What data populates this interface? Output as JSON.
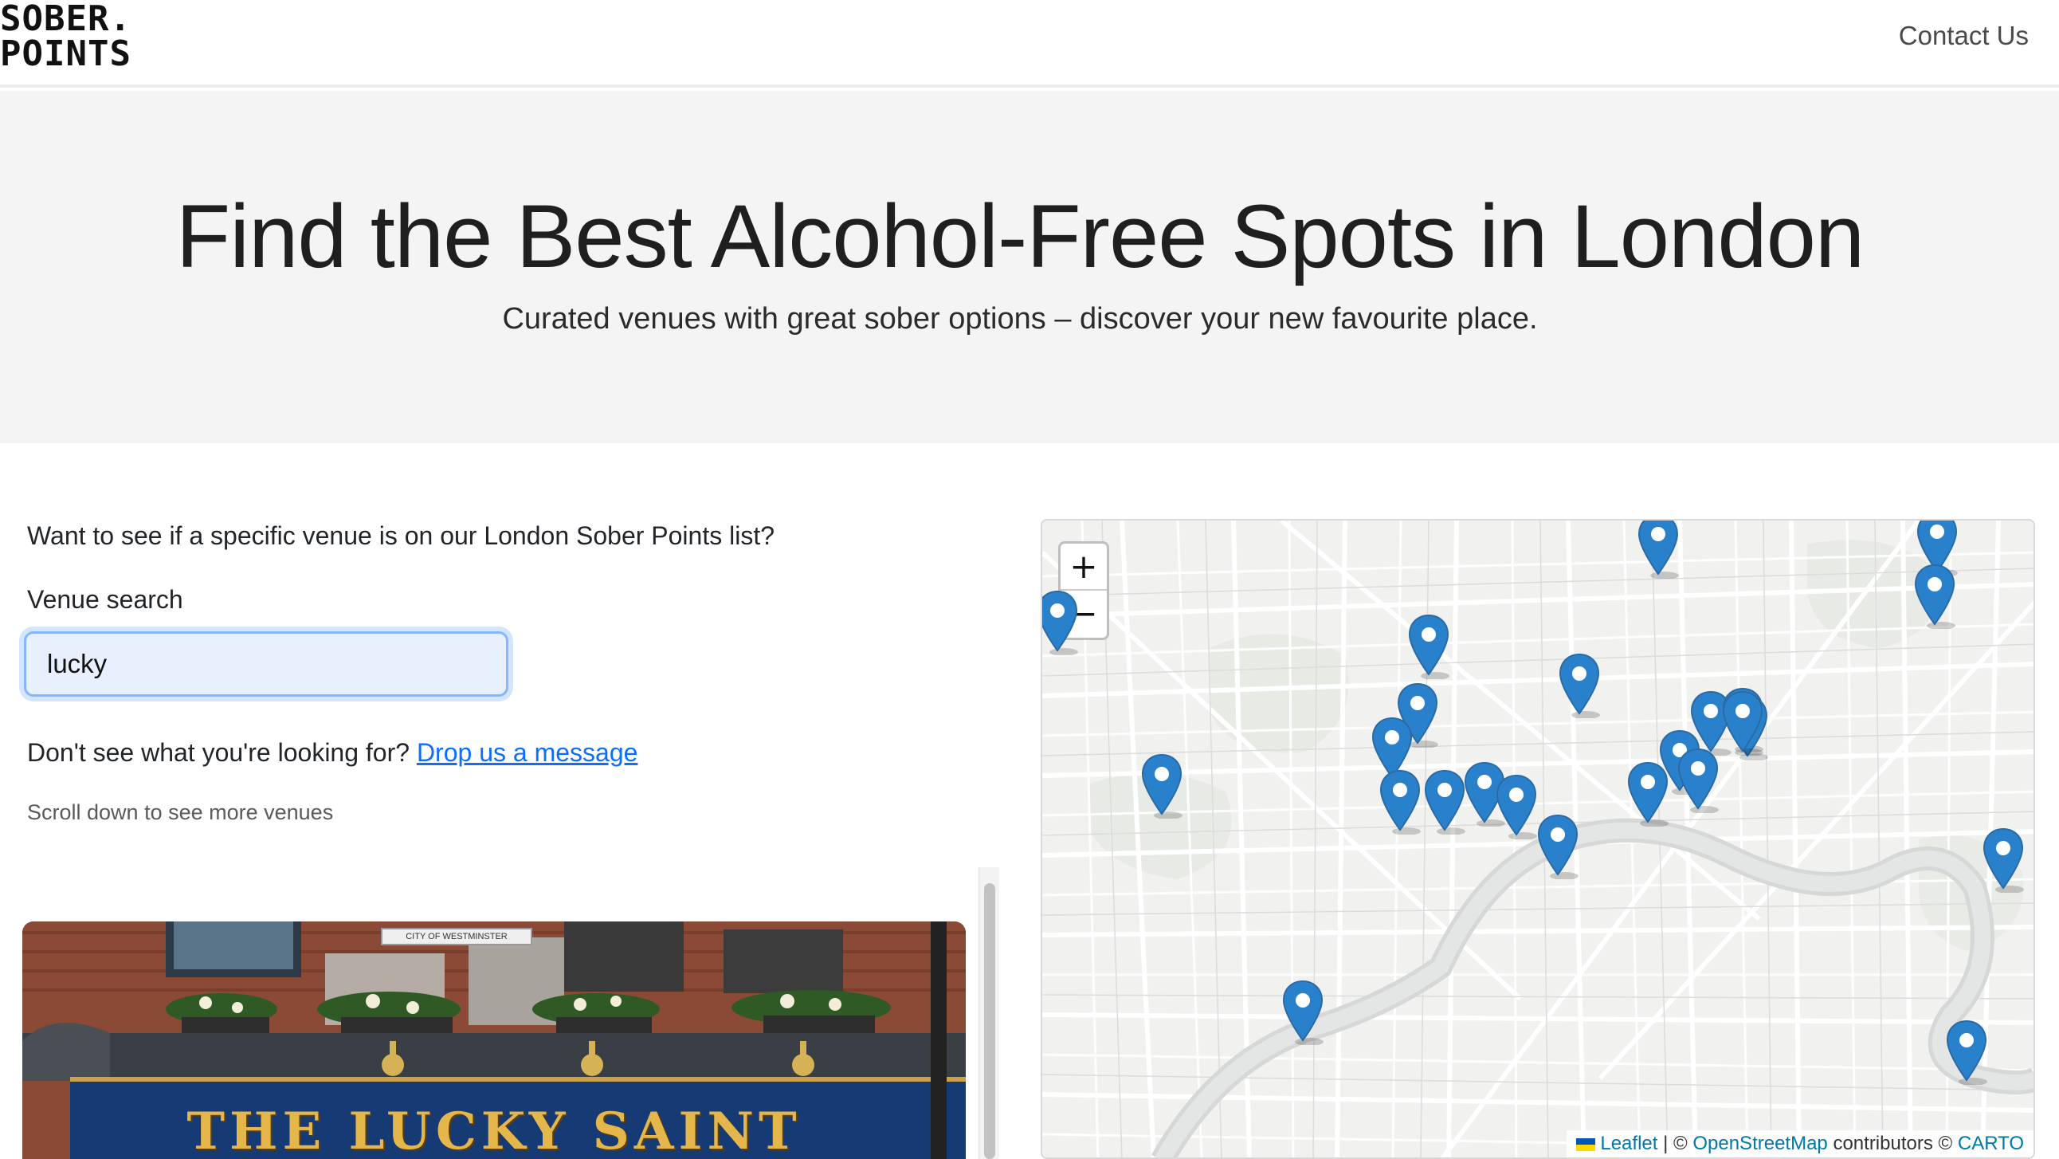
{
  "nav": {
    "logo_line1": "SOBER.",
    "logo_line2": "POINTS",
    "contact": "Contact Us"
  },
  "hero": {
    "title": "Find the Best Alcohol-Free Spots in London",
    "subtitle": "Curated venues with great sober options – discover your new favourite place."
  },
  "search": {
    "question": "Want to see if a specific venue is on our London Sober Points list?",
    "label": "Venue search",
    "value": "lucky",
    "not_found_text": "Don't see what you're looking for?",
    "not_found_link": "Drop us a message",
    "scroll_hint": "Scroll down to see more venues"
  },
  "venue_card": {
    "sign": "THE LUCKY SAINT",
    "council_plaque": "CITY OF WESTMINSTER"
  },
  "map": {
    "zoom_in": "+",
    "zoom_out": "−",
    "attribution": {
      "leaflet": "Leaflet",
      "sep1": " | © ",
      "osm": "OpenStreetMap",
      "contributors": " contributors © ",
      "carto": "CARTO"
    },
    "marker_icon": "map-pin-icon",
    "marker_color": "#2a81cb"
  }
}
